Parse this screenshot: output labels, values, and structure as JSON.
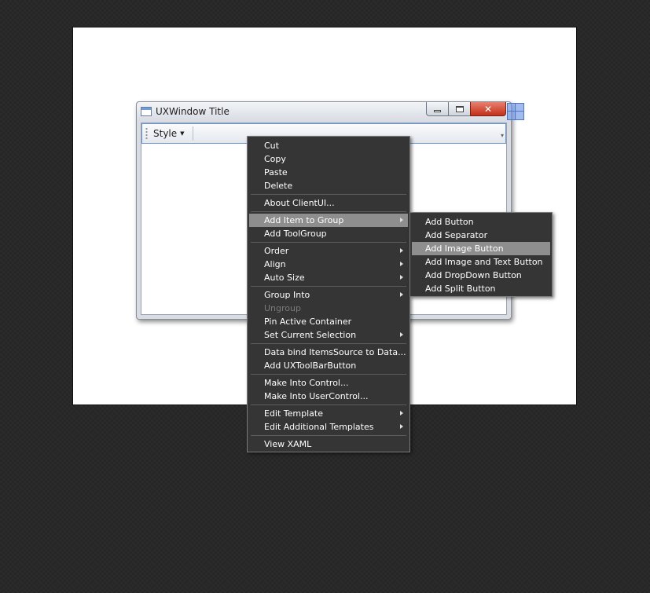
{
  "window": {
    "title": "UXWindow Title",
    "close_glyph": "✕",
    "toolbar": {
      "style_label": "Style",
      "caret_glyph": "▼",
      "overflow_glyph": "▾"
    }
  },
  "context_menu": {
    "groups": [
      [
        "Cut",
        "Copy",
        "Paste",
        "Delete"
      ],
      [
        "About ClientUI..."
      ],
      [
        "Add Item to Group",
        "Add ToolGroup"
      ],
      [
        "Order",
        "Align",
        "Auto Size"
      ],
      [
        "Group Into",
        "Ungroup",
        "Pin Active Container",
        "Set Current Selection"
      ],
      [
        "Data bind ItemsSource to Data...",
        "Add UXToolBarButton"
      ],
      [
        "Make Into Control...",
        "Make Into UserControl..."
      ],
      [
        "Edit Template",
        "Edit Additional Templates"
      ],
      [
        "View XAML"
      ]
    ],
    "highlighted_item": "Add Item to Group",
    "disabled_items": [
      "Ungroup"
    ],
    "submenu_items": [
      "Add Item to Group",
      "Order",
      "Align",
      "Auto Size",
      "Group Into",
      "Set Current Selection",
      "Edit Template",
      "Edit Additional Templates"
    ]
  },
  "submenu": {
    "items": [
      "Add Button",
      "Add Separator",
      "Add Image Button",
      "Add Image and Text Button",
      "Add DropDown Button",
      "Add Split Button"
    ],
    "highlighted_item": "Add Image Button"
  },
  "colors": {
    "menu_bg": "#353535",
    "menu_highlight": "#8e8e8e",
    "menu_disabled_text": "#7a7a7a",
    "close_button": "#c2301a",
    "selection_accent": "#6b96d6"
  }
}
